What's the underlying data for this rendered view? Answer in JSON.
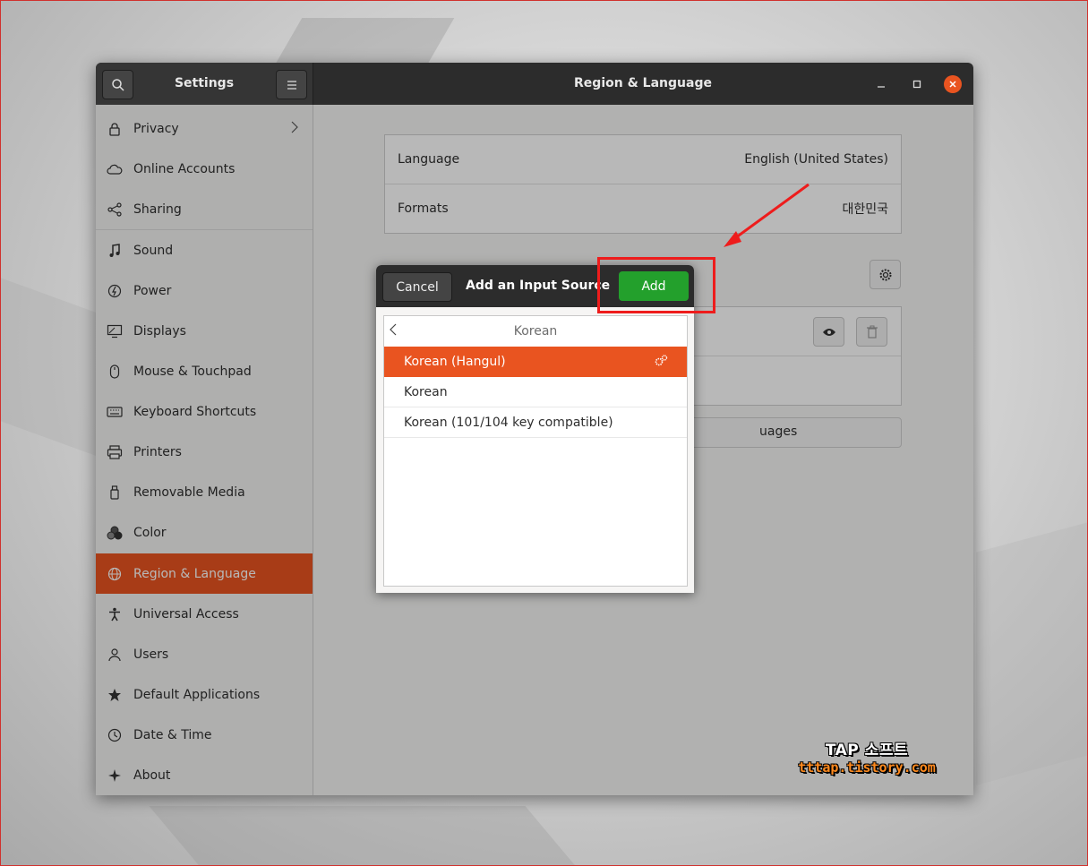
{
  "window": {
    "sidebar_title": "Settings",
    "main_title": "Region & Language"
  },
  "sidebar": {
    "items": [
      {
        "label": "Privacy",
        "icon": "lock-icon",
        "has_chevron": true
      },
      {
        "label": "Online Accounts",
        "icon": "cloud-icon"
      },
      {
        "label": "Sharing",
        "icon": "share-icon"
      },
      {
        "label": "Sound",
        "icon": "music-note-icon"
      },
      {
        "label": "Power",
        "icon": "power-icon"
      },
      {
        "label": "Displays",
        "icon": "display-icon"
      },
      {
        "label": "Mouse & Touchpad",
        "icon": "mouse-icon"
      },
      {
        "label": "Keyboard Shortcuts",
        "icon": "keyboard-icon"
      },
      {
        "label": "Printers",
        "icon": "printer-icon"
      },
      {
        "label": "Removable Media",
        "icon": "usb-drive-icon"
      },
      {
        "label": "Color",
        "icon": "color-icon"
      },
      {
        "label": "Region & Language",
        "icon": "globe-icon",
        "active": true
      },
      {
        "label": "Universal Access",
        "icon": "accessibility-icon"
      },
      {
        "label": "Users",
        "icon": "users-icon"
      },
      {
        "label": "Default Applications",
        "icon": "star-icon"
      },
      {
        "label": "Date & Time",
        "icon": "clock-icon"
      },
      {
        "label": "About",
        "icon": "sparkle-icon"
      }
    ]
  },
  "region": {
    "language_label": "Language",
    "language_value": "English (United States)",
    "formats_label": "Formats",
    "formats_value": "대한민국",
    "manage_languages_partial": "uages"
  },
  "dialog": {
    "cancel_label": "Cancel",
    "title": "Add an Input Source",
    "add_label": "Add",
    "group_title": "Korean",
    "rows": [
      {
        "label": "Korean (Hangul)",
        "selected": true,
        "has_settings": true
      },
      {
        "label": "Korean"
      },
      {
        "label": "Korean (101/104 key compatible)"
      }
    ]
  },
  "watermark": {
    "line1": "TAP 소프트",
    "line2": "tttap.tistory.com"
  },
  "colors": {
    "accent": "#e95420",
    "add_button": "#23a02c",
    "annotation": "#ee1c1c"
  }
}
